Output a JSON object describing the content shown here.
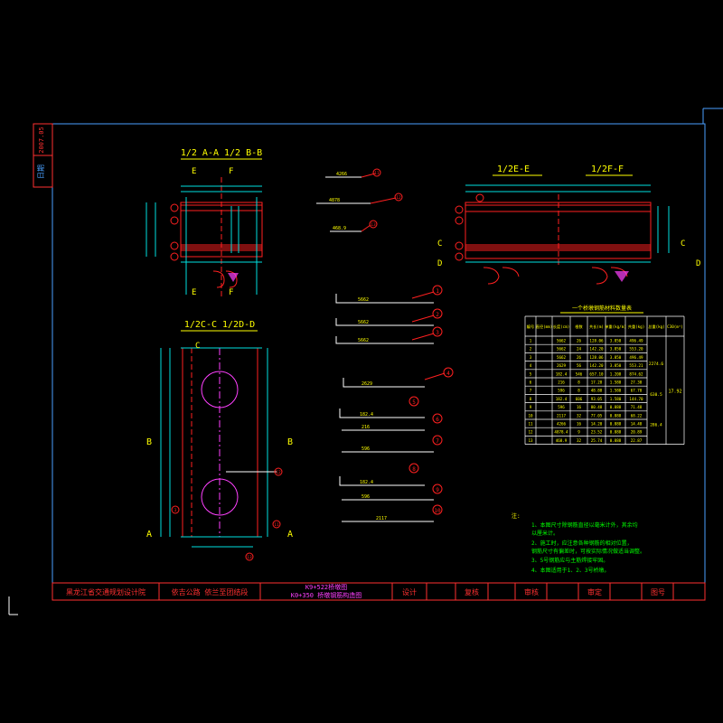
{
  "colors": {
    "frame": "#4aa0ff",
    "text": "#ffff00",
    "red": "#ff2020",
    "cyan": "#00e0e0",
    "green": "#00ff00",
    "magenta": "#ff40ff",
    "white": "#ffffff",
    "title_red": "#ff3030"
  },
  "side_tab": {
    "date": "2007.05",
    "label": "日期"
  },
  "views": {
    "ab_title": "1/2 A-A 1/2 B-B",
    "ef_title_left": "1/2E-E",
    "ef_title_right": "1/2F-F",
    "cd_title": "1/2C-C 1/2D-D",
    "cut_e": "E",
    "cut_f": "F",
    "cut_c": "C",
    "cut_d": "D",
    "cut_a": "A",
    "cut_b": "B"
  },
  "callouts": [
    "1",
    "2",
    "3",
    "4",
    "5",
    "6",
    "7",
    "8",
    "9",
    "10",
    "11",
    "12",
    "13"
  ],
  "bar_labels": {
    "b1": "5662",
    "b2": "5662",
    "b3": "5662",
    "b4": "2629",
    "b5": "182.4",
    "b6": "216",
    "b7": "596",
    "b8": "182.4",
    "b9": "596",
    "b10": "2117",
    "b11": "4266",
    "b12": "4878",
    "b13": "468.9"
  },
  "schedule": {
    "title": "一个桥墩钢筋材料数量表",
    "headers": [
      "编号",
      "直径(mm)",
      "长度(cm)",
      "根数",
      "共长(m)",
      "单重(kg/m)",
      "共重(kg)",
      "总重(kg)",
      "C30(m³)"
    ],
    "rows": [
      [
        "1",
        "",
        "5662",
        "26",
        "128.06",
        "3.850",
        "496.49"
      ],
      [
        "2",
        "",
        "5662",
        "24",
        "142.20",
        "3.850",
        "553.20"
      ],
      [
        "3",
        "",
        "5662",
        "26",
        "128.06",
        "3.850",
        "496.49"
      ],
      [
        "4",
        "",
        "2629",
        "56",
        "142.20",
        "3.850",
        "553.21"
      ],
      [
        "5",
        "",
        "182.4",
        "546",
        "657.10",
        "1.208",
        "874.62"
      ],
      [
        "6",
        "",
        "216",
        "8",
        "17.28",
        "1.580",
        "27.30"
      ],
      [
        "7",
        "",
        "596",
        "8",
        "48.88",
        "1.580",
        "67.70"
      ],
      [
        "8",
        "",
        "182.4",
        "606",
        "93.05",
        "1.580",
        "144.70"
      ],
      [
        "9",
        "",
        "596",
        "16",
        "80.48",
        "0.888",
        "71.48"
      ],
      [
        "10",
        "",
        "2117",
        "32",
        "77.05",
        "0.888",
        "68.22"
      ],
      [
        "11",
        "",
        "4266",
        "16",
        "14.20",
        "0.888",
        "14.48"
      ],
      [
        "12",
        "",
        "4878.4",
        "9",
        "23.52",
        "0.888",
        "20.89"
      ],
      [
        "13",
        "",
        "468.9",
        "32",
        "25.74",
        "0.888",
        "22.87"
      ]
    ],
    "total_groups": [
      "2274.6",
      "630.5",
      "286.4"
    ],
    "concrete": "17.92"
  },
  "notes": {
    "head": "注:",
    "items": [
      "1、本图尺寸除钢筋直径以毫米计外，其余均",
      "   以厘米计。",
      "2、施工时，应注意各种钢筋的相对位置，",
      "   钢筋尺寸有偏差时，可按实际情况做适当调整。",
      "3、5号钢筋应与主筋焊接牢固。",
      "4、本图适用于1、2、3号桥墩。"
    ]
  },
  "title_block": {
    "institute": "黑龙江省交通规划设计院",
    "project": "依吉公路  依兰至团结段",
    "station1": "K9+522桥墩图",
    "station2": "K0+350  桥墩钢筋构造图",
    "design": "设计",
    "review": "复核",
    "check": "审核",
    "approve": "审定",
    "drawing_no": "图号"
  }
}
